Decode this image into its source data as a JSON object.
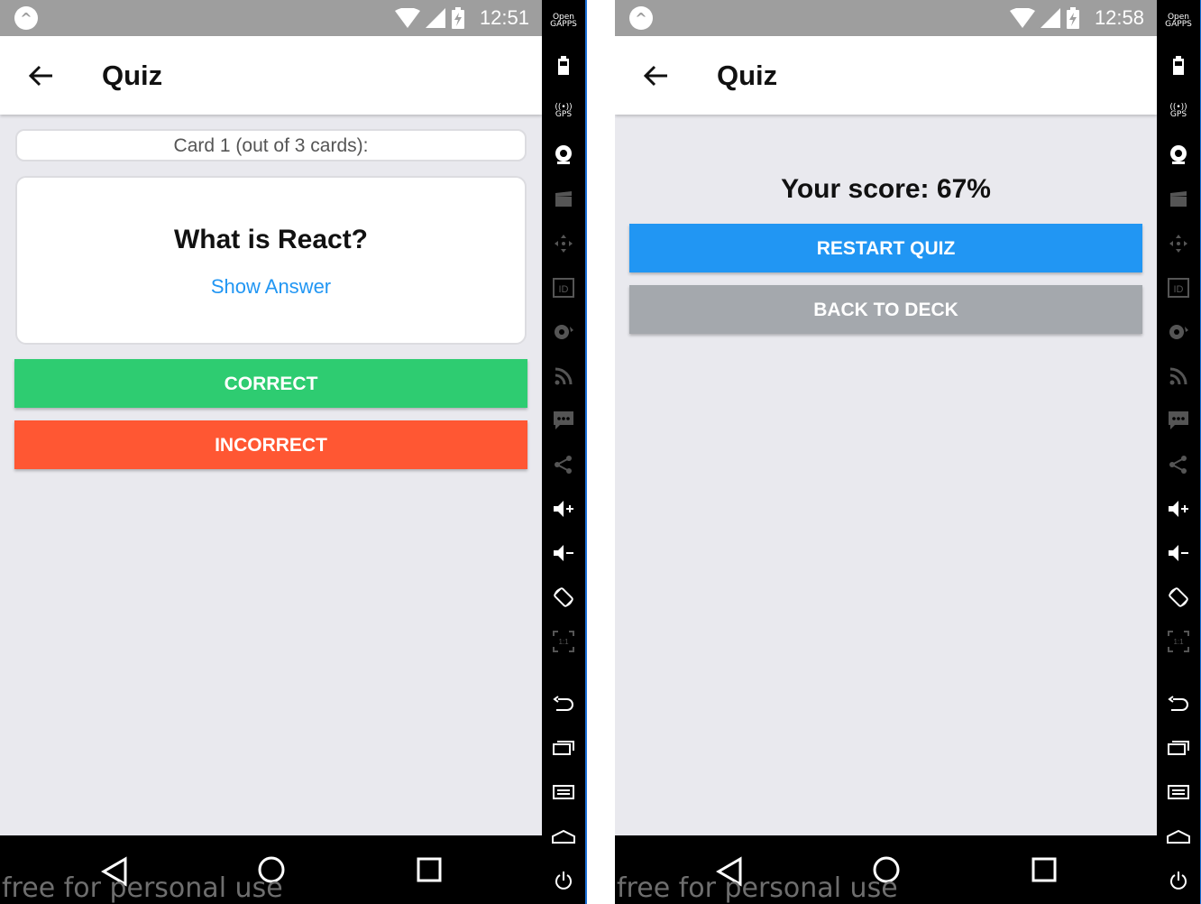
{
  "screens": {
    "left": {
      "status_time": "12:51",
      "title": "Quiz",
      "counter": "Card 1 (out of 3 cards):",
      "question": "What is React?",
      "show_answer": "Show Answer",
      "correct_label": "CORRECT",
      "incorrect_label": "INCORRECT"
    },
    "right": {
      "status_time": "12:58",
      "title": "Quiz",
      "score": "Your score: 67%",
      "restart_label": "RESTART QUIZ",
      "back_to_deck_label": "BACK TO DECK"
    }
  },
  "watermark": "free for personal use",
  "toolbar": {
    "open_gapps": "Open GAPPS",
    "gps": "GPS",
    "id": "ID",
    "zoom": "1:1",
    "items": [
      "open-gapps",
      "battery",
      "gps",
      "camera",
      "media",
      "move",
      "id",
      "disk",
      "rss",
      "sms",
      "share",
      "volume-up",
      "volume-down",
      "rotate",
      "zoom",
      "back",
      "recents",
      "menu",
      "home",
      "power"
    ]
  },
  "colors": {
    "correct": "#2ecc71",
    "incorrect": "#ff5733",
    "restart": "#2196f3",
    "back_to_deck": "#a4a8ad",
    "link": "#2196f3",
    "statusbar": "#9e9e9e",
    "background": "#e9e9ee"
  }
}
